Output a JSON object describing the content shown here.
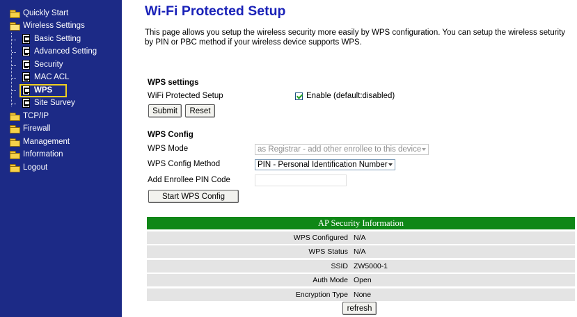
{
  "sidebar": {
    "items": [
      {
        "label": "Quickly Start"
      },
      {
        "label": "Wireless Settings"
      },
      {
        "label": "Basic Setting"
      },
      {
        "label": "Advanced Setting"
      },
      {
        "label": "Security"
      },
      {
        "label": "MAC ACL"
      },
      {
        "label": "WPS"
      },
      {
        "label": "Site Survey"
      },
      {
        "label": "TCP/IP"
      },
      {
        "label": "Firewall"
      },
      {
        "label": "Management"
      },
      {
        "label": "Information"
      },
      {
        "label": "Logout"
      }
    ],
    "selected": "WPS"
  },
  "page": {
    "title": "Wi-Fi Protected Setup",
    "description": "This page allows you setup the wireless security more easily by WPS configuration. You can setup the wireless seturity by PIN or PBC method if your wireless device supports WPS."
  },
  "wps_settings": {
    "heading": "WPS settings",
    "wifi_label": "WiFi Protected Setup",
    "enable_label": "Enable (default:disabled)",
    "enable_checked": true,
    "submit_label": "Submit",
    "reset_label": "Reset"
  },
  "wps_config": {
    "heading": "WPS Config",
    "mode_label": "WPS Mode",
    "mode_value": "as Registrar - add other enrollee to this device",
    "method_label": "WPS Config Method",
    "method_value": "PIN - Personal Identification Number",
    "pin_label": "Add Enrollee PIN Code",
    "pin_value": "",
    "start_label": "Start WPS Config"
  },
  "ap_info": {
    "header": "AP Security Information",
    "rows": [
      {
        "key": "WPS Configured",
        "value": "N/A"
      },
      {
        "key": "WPS Status",
        "value": "N/A"
      },
      {
        "key": "SSID",
        "value": "ZW5000-1"
      },
      {
        "key": "Auth Mode",
        "value": "Open"
      },
      {
        "key": "Encryption Type",
        "value": "None"
      }
    ],
    "refresh_label": "refresh"
  },
  "colors": {
    "sidebar_bg": "#1c2a86",
    "title": "#1a22b8",
    "table_header": "#0f8717",
    "highlight": "#f0d020"
  }
}
